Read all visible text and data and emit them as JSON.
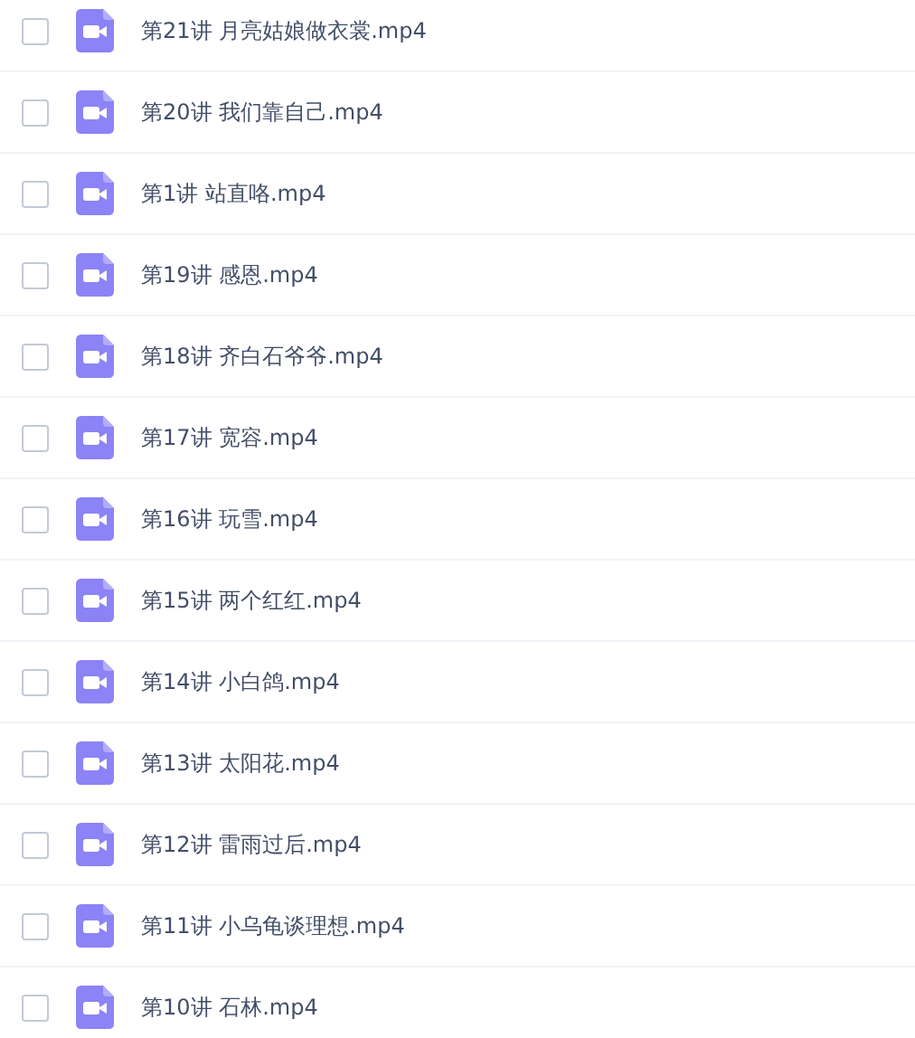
{
  "files": [
    {
      "name": "第21讲 月亮姑娘做衣裳.mp4",
      "checked": false
    },
    {
      "name": "第20讲 我们靠自己.mp4",
      "checked": false
    },
    {
      "name": "第1讲 站直咯.mp4",
      "checked": false
    },
    {
      "name": "第19讲 感恩.mp4",
      "checked": false
    },
    {
      "name": "第18讲 齐白石爷爷.mp4",
      "checked": false
    },
    {
      "name": "第17讲 宽容.mp4",
      "checked": false
    },
    {
      "name": "第16讲 玩雪.mp4",
      "checked": false
    },
    {
      "name": "第15讲 两个红红.mp4",
      "checked": false
    },
    {
      "name": "第14讲 小白鸽.mp4",
      "checked": false
    },
    {
      "name": "第13讲 太阳花.mp4",
      "checked": false
    },
    {
      "name": "第12讲 雷雨过后.mp4",
      "checked": false
    },
    {
      "name": "第11讲 小乌龟谈理想.mp4",
      "checked": false
    },
    {
      "name": "第10讲 石林.mp4",
      "checked": false
    }
  ]
}
